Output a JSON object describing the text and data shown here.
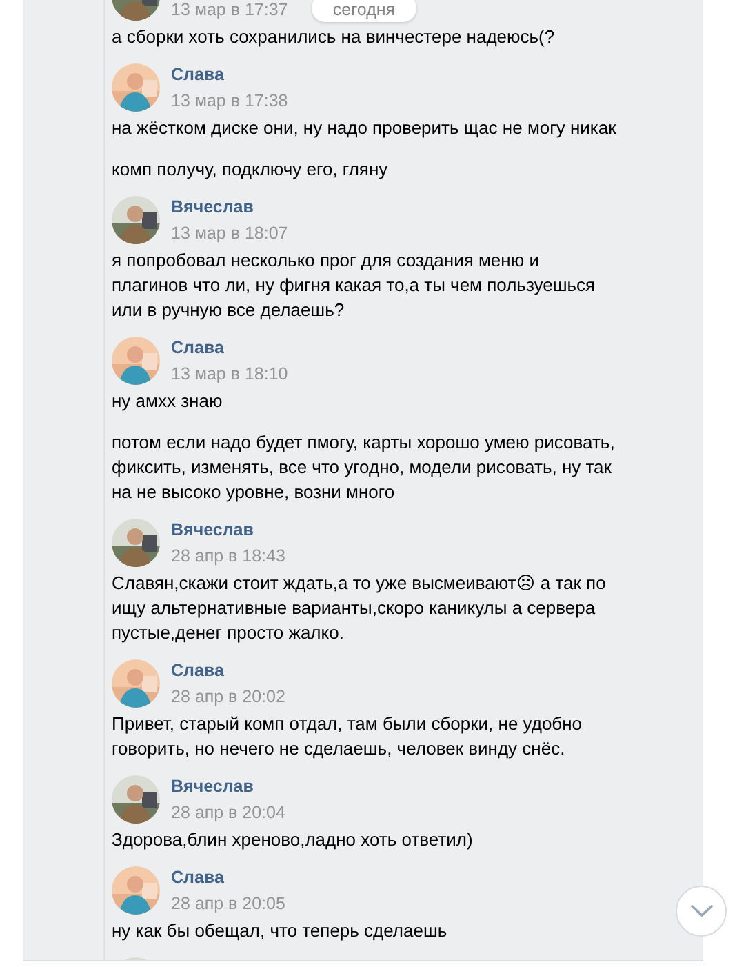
{
  "date_badge": "сегодня",
  "messages": [
    {
      "time": "13 мар в 17:37",
      "avatar": {
        "kind": "picture"
      },
      "texts": [
        "а сборки хоть сохранились на винчестере надеюсь(?"
      ]
    },
    {
      "author": "Слава",
      "time": "13 мар в 17:38",
      "avatar": {
        "kind": "picture"
      },
      "texts": [
        "на жёстком диске они, ну надо проверить щас не могу никак",
        "комп получу, подключу его, гляну"
      ]
    },
    {
      "author": "Вячеслав",
      "time": "13 мар в 18:07",
      "avatar": {
        "kind": "picture"
      },
      "texts": [
        "я попробовал несколько прог для создания меню и плагинов что ли, ну фигня какая то,а ты чем пользуешься или в ручную все делаешь?"
      ]
    },
    {
      "author": "Слава",
      "time": "13 мар в 18:10",
      "avatar": {
        "kind": "picture"
      },
      "texts": [
        "ну амхх знаю",
        "потом если надо будет пмогу, карты хорошо умею рисовать, фиксить, изменять, все что угодно, модели рисовать, ну так на не высоко уровне, возни много"
      ]
    },
    {
      "author": "Вячеслав",
      "time": "28 апр в 18:43",
      "avatar": {
        "kind": "picture"
      },
      "texts": [
        "Славян,скажи стоит ждать,а то уже высмеивают☹ а так по ищу альтернативные варианты,скоро каникулы а сервера пустые,денег просто жалко."
      ]
    },
    {
      "author": "Слава",
      "time": "28 апр в 20:02",
      "avatar": {
        "kind": "picture"
      },
      "texts": [
        "Привет, старый комп отдал, там были сборки, не удобно говорить, но нечего не сделаешь, человек винду снёс."
      ]
    },
    {
      "author": "Вячеслав",
      "time": "28 апр в 20:04",
      "avatar": {
        "kind": "picture"
      },
      "texts": [
        "Здорова,блин хреново,ладно хоть ответил)"
      ]
    },
    {
      "author": "Слава",
      "time": "28 апр в 20:05",
      "avatar": {
        "kind": "picture"
      },
      "texts": [
        "ну как бы обещал, что теперь сделаешь"
      ]
    },
    {
      "avatar": {
        "kind": "picture"
      }
    }
  ]
}
